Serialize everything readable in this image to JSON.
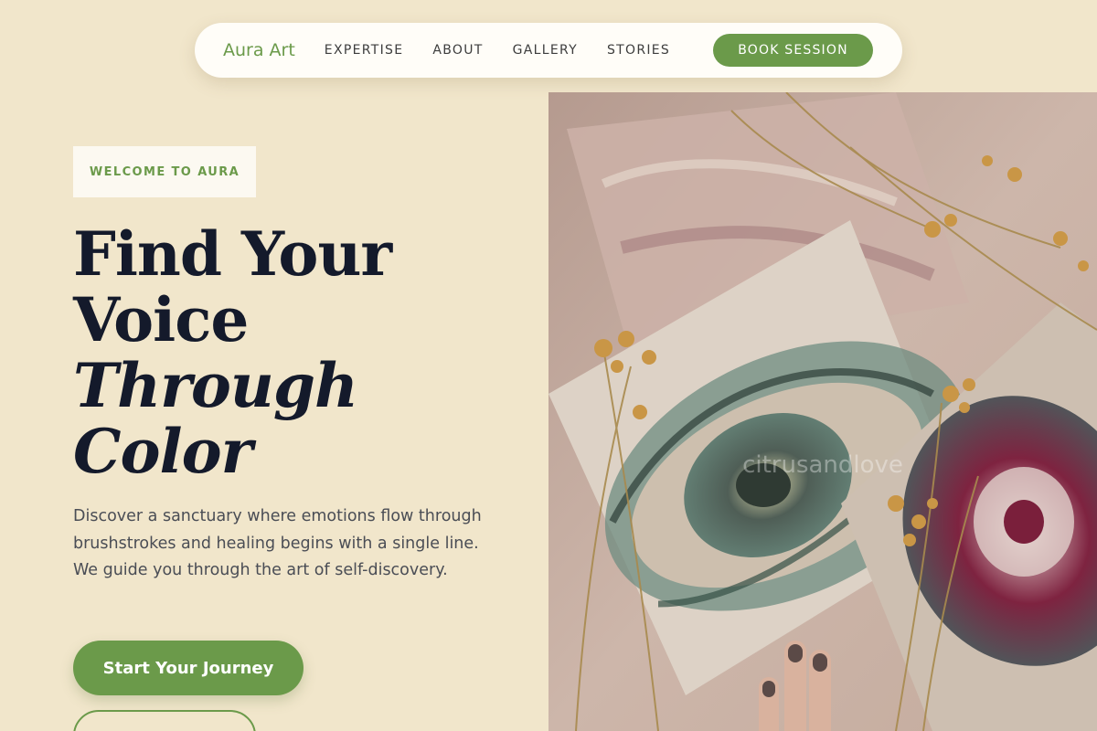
{
  "nav": {
    "brand": "Aura Art",
    "links": [
      "EXPERTISE",
      "ABOUT",
      "GALLERY",
      "STORIES"
    ],
    "cta": "BOOK SESSION"
  },
  "hero": {
    "eyebrow": "WELCOME TO AURA",
    "headline": {
      "line1": "Find Your",
      "line2": "Voice",
      "line3": "Through",
      "line4": "Color"
    },
    "description": "Discover a sanctuary where emotions flow through brushstrokes and healing begins with a single line. We guide you through the art of self-discovery.",
    "primary_cta": "Start Your Journey",
    "secondary_cta": ""
  },
  "image": {
    "watermark": "citrusandlove"
  },
  "colors": {
    "background": "#f1e6cb",
    "accent": "#6b9a4a",
    "heading": "#141a2b"
  }
}
